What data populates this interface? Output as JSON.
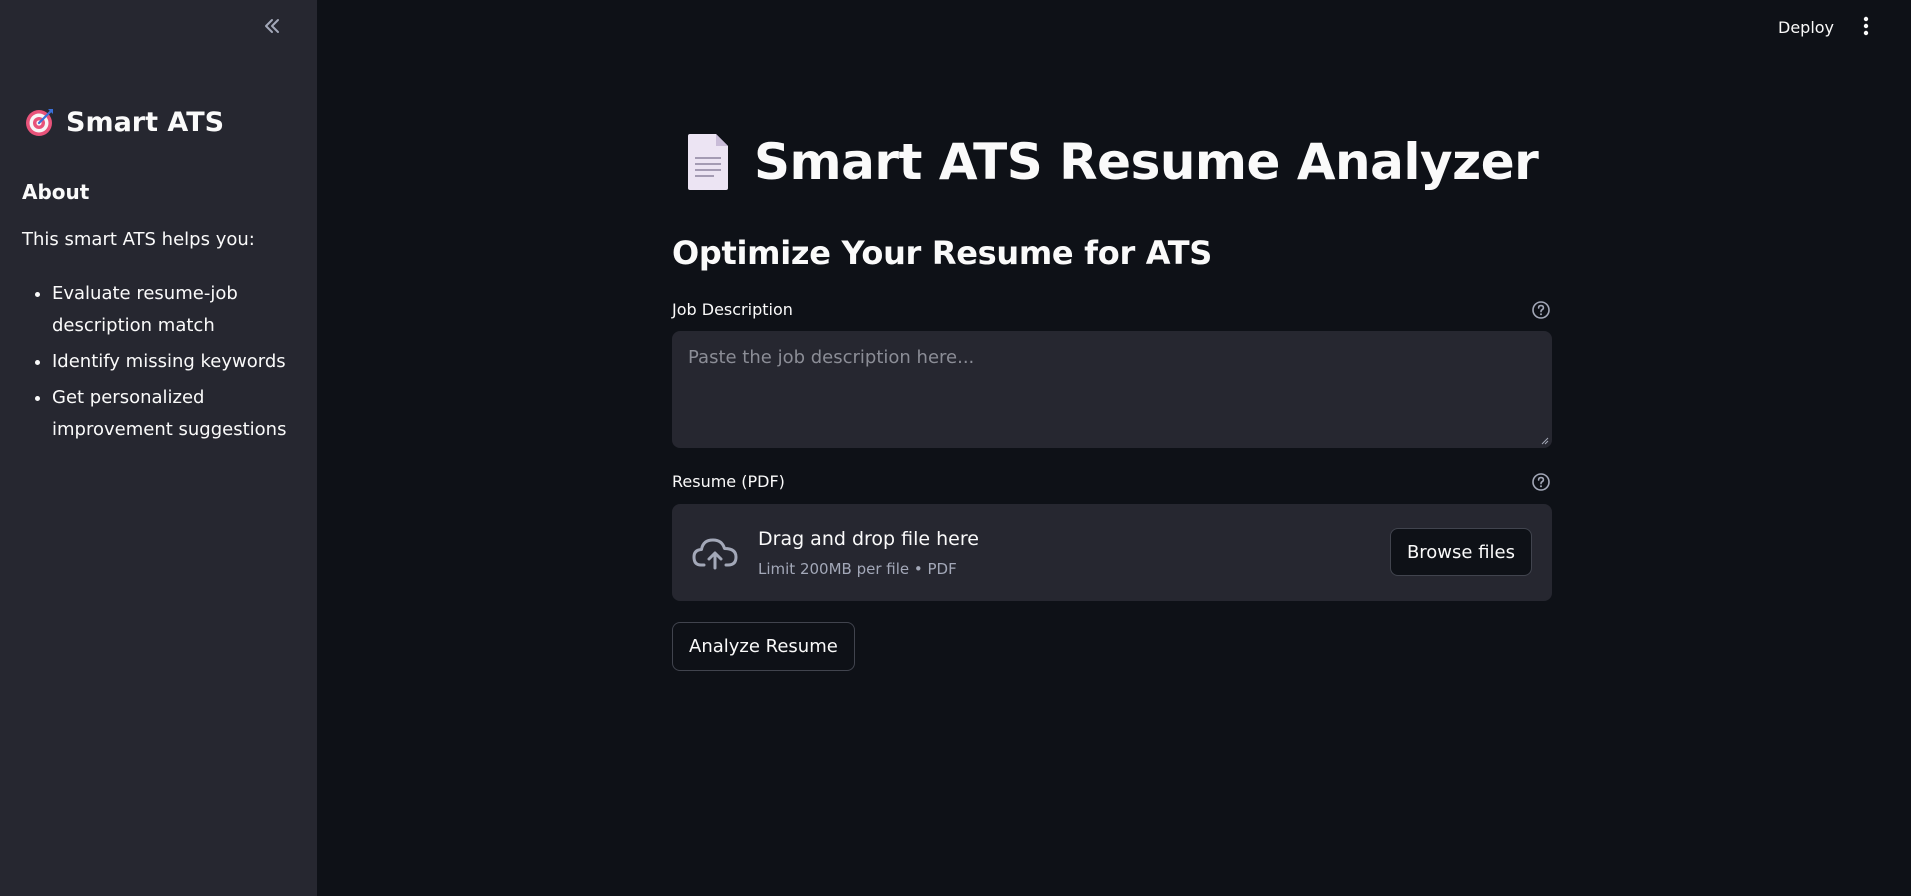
{
  "sidebar": {
    "title": "Smart ATS",
    "title_icon": "target-icon",
    "about_heading": "About",
    "intro": "This smart ATS helps you:",
    "items": [
      "Evaluate resume-job description match",
      "Identify missing keywords",
      "Get personalized improvement suggestions"
    ]
  },
  "header": {
    "deploy_label": "Deploy",
    "menu_icon": "kebab-menu-icon"
  },
  "main": {
    "title": "Smart ATS Resume Analyzer",
    "title_icon": "document-icon",
    "subheader": "Optimize Your Resume for ATS",
    "job_description": {
      "label": "Job Description",
      "placeholder": "Paste the job description here...",
      "value": ""
    },
    "resume": {
      "label": "Resume (PDF)",
      "drop_text": "Drag and drop file here",
      "limit_text": "Limit 200MB per file • PDF",
      "browse_label": "Browse files"
    },
    "analyze_label": "Analyze Resume"
  },
  "colors": {
    "background": "#0e1117",
    "sidebar": "#262730",
    "input": "#262730",
    "text": "#fafafa",
    "muted": "#a3a8b8",
    "border": "#41444e"
  }
}
